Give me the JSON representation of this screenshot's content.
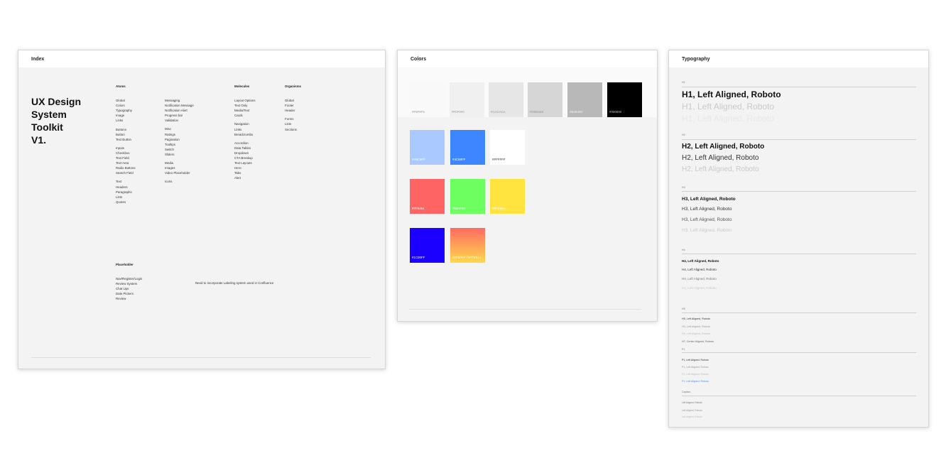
{
  "index": {
    "title": "Index",
    "heading_lines": [
      "UX Design",
      "System",
      "Toolkit",
      "V1."
    ],
    "atoms": {
      "heading": "Atoms",
      "items": [
        "Global",
        "Colors",
        "Typography",
        "Image",
        "Links",
        "",
        "Buttons",
        "Button",
        "Text Button",
        "",
        "Inputs",
        "Checkbox",
        "Text Field",
        "Text Area",
        "Radio Buttons",
        "Search Field",
        "",
        "Text",
        "Headers",
        "Paragraphs",
        "Lists",
        "Quotes"
      ]
    },
    "atoms2": {
      "items": [
        "Messaging",
        "Notification Message",
        "Notification Alert",
        "Progress bar",
        "Validation",
        "",
        "Misc",
        "Ratings",
        "Pagination",
        "Tooltips",
        "Switch",
        "Sliders",
        "",
        "Media",
        "Images",
        "Video Placeholder",
        "",
        "Icons"
      ]
    },
    "molecules": {
      "heading": "Molecules",
      "items": [
        "Layout Options",
        "Text Only",
        "Media/Text",
        "Cards",
        "",
        "Navigation",
        "Links",
        "Breadcrumbs",
        "",
        "Accordion",
        "Data Tables",
        "Dropdown",
        "CTA Breakup",
        "Text Layouts",
        "Hero",
        "Tabs",
        "Alert"
      ]
    },
    "organisms": {
      "heading": "Organisms",
      "items": [
        "Global",
        "Footer",
        "Header",
        "",
        "Forms",
        "Lists",
        "Sections"
      ]
    },
    "placeholder": {
      "heading": "Placeholder",
      "items": [
        "Nav/Register/Login",
        "Review System",
        "Chat Ups",
        "Date Pickers",
        "Review"
      ],
      "note": "Need to incorporate Labeling system used in Confluence"
    }
  },
  "colors": {
    "title": "Colors",
    "swatches": [
      {
        "hex": "#F9F9F9",
        "label": "#F9F9F9",
        "text": "#999999"
      },
      {
        "hex": "#F0F0F0",
        "label": "#F0F0F0",
        "text": "#999999"
      },
      {
        "hex": "#E6E6E6",
        "label": "#CACACA",
        "text": "#999999"
      },
      {
        "hex": "#D6D6D6",
        "label": "#D6D6D6",
        "text": "#999999"
      },
      {
        "hex": "#B8B8B8",
        "label": "#B4B4B4",
        "text": "#eeeeee"
      },
      {
        "hex": "#000000",
        "label": "#000000",
        "text": "#bbbbbb"
      },
      {
        "hex": "#A9C9FF",
        "label": "#A9C9FF",
        "text": "#ffffff"
      },
      {
        "hex": "#3E86FF",
        "label": "#4C88FF",
        "text": "#ffffff"
      },
      {
        "hex": "#FFFFFF",
        "label": "#FFFFFF",
        "text": "#333333"
      },
      {
        "hex": "#FF6464",
        "label": "#FF6464",
        "text": "#ffffff"
      },
      {
        "hex": "#6DFF5F",
        "label": "#69FF69",
        "text": "#ffffff"
      },
      {
        "hex": "#FFE33F",
        "label": "#FFE55A",
        "text": "#ffffff"
      },
      {
        "hex": "#1C00FF",
        "label": "#1C00FF",
        "text": "#ffffff"
      },
      {
        "hex": "#FF6A64",
        "label": "#FF5FFF / #FFE642",
        "text": "#ffffff",
        "gradient_to": "#FFD94A"
      }
    ]
  },
  "typography": {
    "title": "Typography",
    "groups": [
      {
        "tag": "H1",
        "lines": [
          "H1, Left Aligned, Roboto",
          "H1, Left Aligned, Roboto",
          "H1, Left Aligned, Roboto"
        ]
      },
      {
        "tag": "H2",
        "lines": [
          "H2, Left Aligned, Roboto",
          "H2, Left Aligned, Roboto",
          "H2, Left Aligned, Roboto"
        ]
      },
      {
        "tag": "H3",
        "lines": [
          "H3, Left Aligned, Roboto",
          "H3, Left Aligned, Roboto",
          "H3, Left Aligned, Roboto",
          "H3, Left Aligned, Roboto"
        ]
      },
      {
        "tag": "H4",
        "lines": [
          "H4, Left Aligned, Roboto",
          "H4, Left Aligned, Roboto",
          "H4, Left Aligned, Roboto",
          "H4, Left Aligned, Roboto"
        ]
      },
      {
        "tag": "H5",
        "lines": [
          "H5, Left Aligned, Roboto",
          "H5, Left Aligned, Roboto",
          "H5, Left Aligned, Roboto",
          "H7, Center Aligned, Roboto"
        ]
      },
      {
        "tag": "P1",
        "lines": [
          "P1, Left Aligned, Roboto",
          "P1, Left Aligned, Roboto",
          "P1, Left Aligned, Roboto",
          "P1, Left Aligned, Roboto"
        ]
      },
      {
        "tag": "Caption",
        "lines": [
          "Left Aligned, Roboto",
          "Left Aligned, Roboto",
          "Left Aligned, Roboto"
        ]
      }
    ]
  }
}
